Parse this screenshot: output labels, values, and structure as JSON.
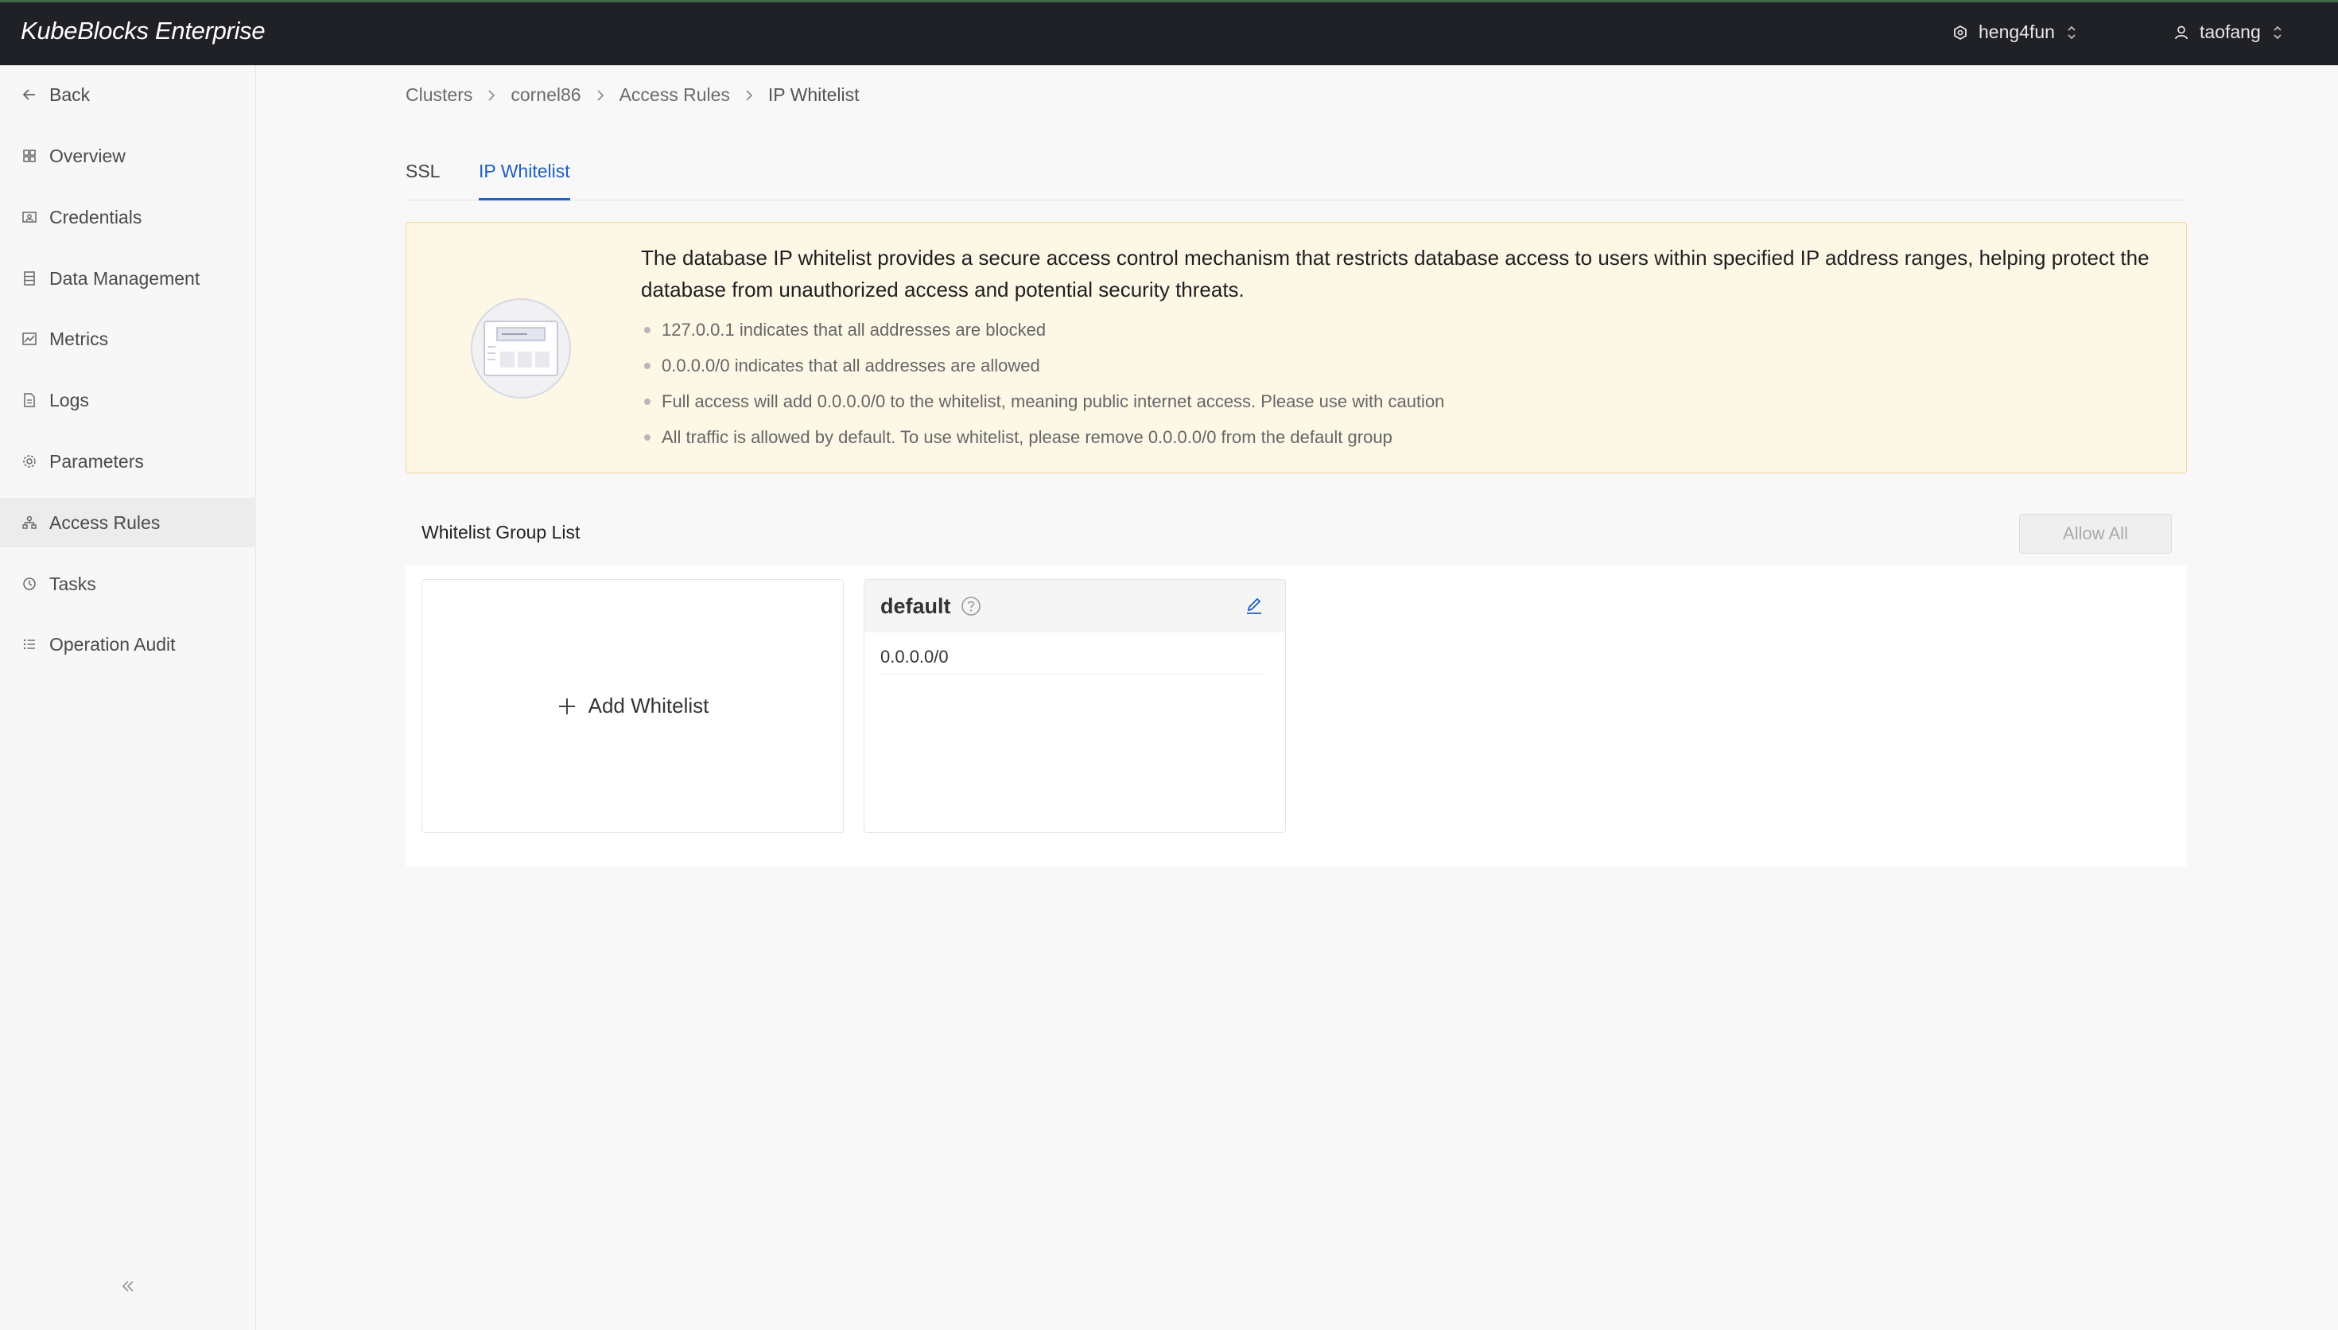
{
  "app": {
    "brand": "KubeBlocks Enterprise",
    "tenant": "heng4fun",
    "user": "taofang"
  },
  "sidebar": {
    "items": [
      {
        "label": "Back",
        "icon": "arrow-left-icon"
      },
      {
        "label": "Overview",
        "icon": "grid-icon"
      },
      {
        "label": "Credentials",
        "icon": "credentials-icon"
      },
      {
        "label": "Data Management",
        "icon": "database-icon"
      },
      {
        "label": "Metrics",
        "icon": "chart-icon"
      },
      {
        "label": "Logs",
        "icon": "log-file-icon"
      },
      {
        "label": "Parameters",
        "icon": "gear-icon"
      },
      {
        "label": "Access Rules",
        "icon": "access-rules-icon"
      },
      {
        "label": "Tasks",
        "icon": "clock-icon"
      },
      {
        "label": "Operation Audit",
        "icon": "list-icon"
      }
    ],
    "active": "Access Rules"
  },
  "breadcrumb": [
    "Clusters",
    "cornel86",
    "Access Rules",
    "IP Whitelist"
  ],
  "tabs": [
    {
      "label": "SSL",
      "active": false
    },
    {
      "label": "IP Whitelist",
      "active": true
    }
  ],
  "notice": {
    "title": "The database IP whitelist provides a secure access control mechanism that restricts database access to users within specified IP address ranges, helping protect the database from unauthorized access and potential security threats.",
    "items": [
      "127.0.0.1 indicates that all addresses are blocked",
      "0.0.0.0/0 indicates that all addresses are allowed",
      "Full access will add 0.0.0.0/0 to the whitelist, meaning public internet access. Please use with caution",
      "All traffic is allowed by default. To use whitelist, please remove 0.0.0.0/0 from the default group"
    ]
  },
  "whitelist": {
    "section_title": "Whitelist Group List",
    "allow_all_label": "Allow All",
    "add_label": "Add Whitelist",
    "groups": [
      {
        "name": "default",
        "ips": [
          "0.0.0.0/0"
        ]
      }
    ]
  },
  "colors": {
    "topbar": "#1f2126",
    "accent": "#1f5fbf",
    "notice_bg": "#fdf7e6",
    "notice_border": "#f3d89b"
  }
}
